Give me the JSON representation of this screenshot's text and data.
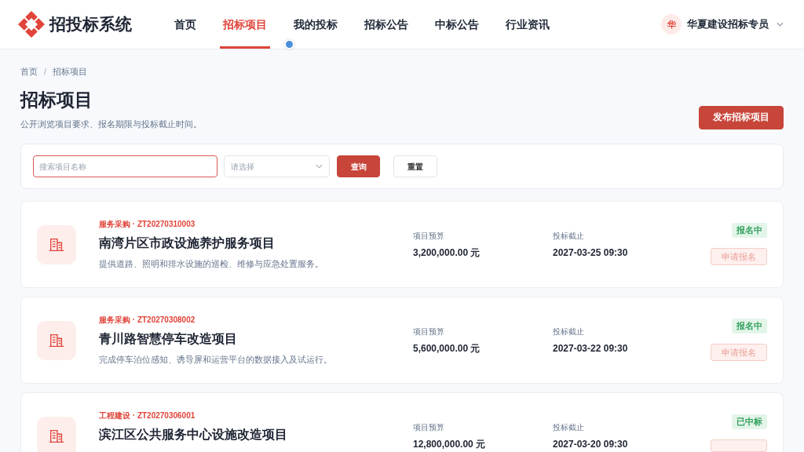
{
  "brand": {
    "name": "招投标系统"
  },
  "nav": [
    {
      "label": "首页",
      "selected": false
    },
    {
      "label": "招标项目",
      "selected": true
    },
    {
      "label": "我的投标",
      "selected": false
    },
    {
      "label": "招标公告",
      "selected": false
    },
    {
      "label": "中标公告",
      "selected": false
    },
    {
      "label": "行业资讯",
      "selected": false
    }
  ],
  "user": {
    "avatar_text": "华",
    "name": "华夏建设招标专员"
  },
  "breadcrumb": {
    "items": [
      "首页",
      "招标项目"
    ],
    "separator": "/"
  },
  "page": {
    "title": "招标项目",
    "subtitle": "公开浏览项目要求、报名期限与投标截止时间。",
    "publish_button": "发布招标项目"
  },
  "filters": {
    "search": {
      "placeholder": "搜索项目名称",
      "focused": true
    },
    "category": {
      "placeholder": "请选择"
    },
    "query_button": "查询",
    "reset_button": "重置"
  },
  "projects": [
    {
      "tag": "服务采购 · ZT20270310003",
      "title": "南湾片区市政设施养护服务项目",
      "description": "提供道路、照明和排水设施的巡检、维修与应急处置服务。",
      "budget_label": "项目预算",
      "budget": "3,200,000.00 元",
      "deadline_label": "投标截止",
      "deadline": "2027-03-25 09:30",
      "status": "报名中",
      "apply": {
        "label": "申请报名",
        "disabled": true
      }
    },
    {
      "tag": "服务采购 · ZT20270308002",
      "title": "青川路智慧停车改造项目",
      "description": "完成停车泊位感知、诱导屏和运营平台的数据接入及试运行。",
      "budget_label": "项目预算",
      "budget": "5,600,000.00 元",
      "deadline_label": "投标截止",
      "deadline": "2027-03-22 09:30",
      "status": "报名中",
      "apply": {
        "label": "申请报名",
        "disabled": true
      }
    },
    {
      "tag": "工程建设 · ZT20270306001",
      "title": "滨江区公共服务中心设施改造项目",
      "budget_label": "项目预算",
      "budget": "12,800,000.00 元",
      "deadline_label": "投标截止",
      "deadline": "2027-03-20 09:30",
      "status": "已中标",
      "apply": {
        "disabled": true
      }
    }
  ]
}
